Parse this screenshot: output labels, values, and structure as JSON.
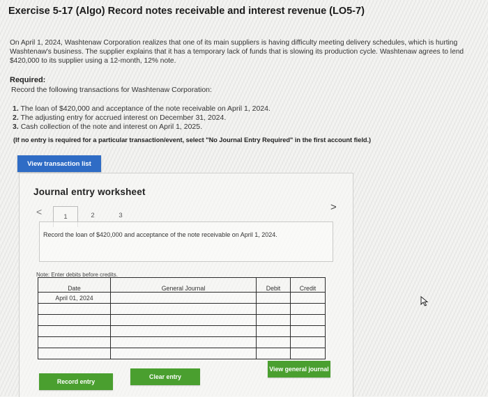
{
  "header": {
    "title": "Exercise 5-17 (Algo) Record notes receivable and interest revenue (LO5-7)"
  },
  "intro": "On April 1, 2024, Washtenaw Corporation realizes that one of its main suppliers is having difficulty meeting delivery schedules, which is hurting Washtenaw's business. The supplier explains that it has a temporary lack of funds that is slowing its production cycle. Washtenaw agrees to lend $420,000 to its supplier using a 12-month, 12% note.",
  "required": {
    "label": "Required:",
    "text": "Record the following transactions for Washtenaw Corporation:",
    "items": [
      {
        "num": "1.",
        "text": "The loan of $420,000 and acceptance of the note receivable on April 1, 2024."
      },
      {
        "num": "2.",
        "text": "The adjusting entry for accrued interest on December 31, 2024."
      },
      {
        "num": "3.",
        "text": "Cash collection of the note and interest on April 1, 2025."
      }
    ],
    "note": "(If no entry is required for a particular transaction/event, select \"No Journal Entry Required\" in the first account field.)"
  },
  "buttons": {
    "view_transaction_list": "View transaction list",
    "record_entry": "Record entry",
    "clear_entry": "Clear entry",
    "view_general_journal": "View general journal"
  },
  "worksheet": {
    "title": "Journal entry worksheet",
    "prev_arrow": "<",
    "next_arrow": ">",
    "tabs": [
      "1",
      "2",
      "3"
    ],
    "active_tab": "1",
    "description": "Record the loan of $420,000 and acceptance of the note receivable on April 1, 2024.",
    "note": "Note: Enter debits before credits."
  },
  "journal_table": {
    "headers": {
      "date": "Date",
      "general_journal": "General Journal",
      "debit": "Debit",
      "credit": "Credit"
    },
    "rows": [
      {
        "date": "April 01, 2024",
        "account": "",
        "debit": "",
        "credit": ""
      },
      {
        "date": "",
        "account": "",
        "debit": "",
        "credit": ""
      },
      {
        "date": "",
        "account": "",
        "debit": "",
        "credit": ""
      },
      {
        "date": "",
        "account": "",
        "debit": "",
        "credit": ""
      },
      {
        "date": "",
        "account": "",
        "debit": "",
        "credit": ""
      },
      {
        "date": "",
        "account": "",
        "debit": "",
        "credit": ""
      }
    ]
  },
  "colors": {
    "blue_button": "#2f6cc5",
    "green_button": "#4a9f2f",
    "background": "#f4f4f2"
  },
  "icons": {
    "cursor": "mouse-pointer-icon"
  }
}
